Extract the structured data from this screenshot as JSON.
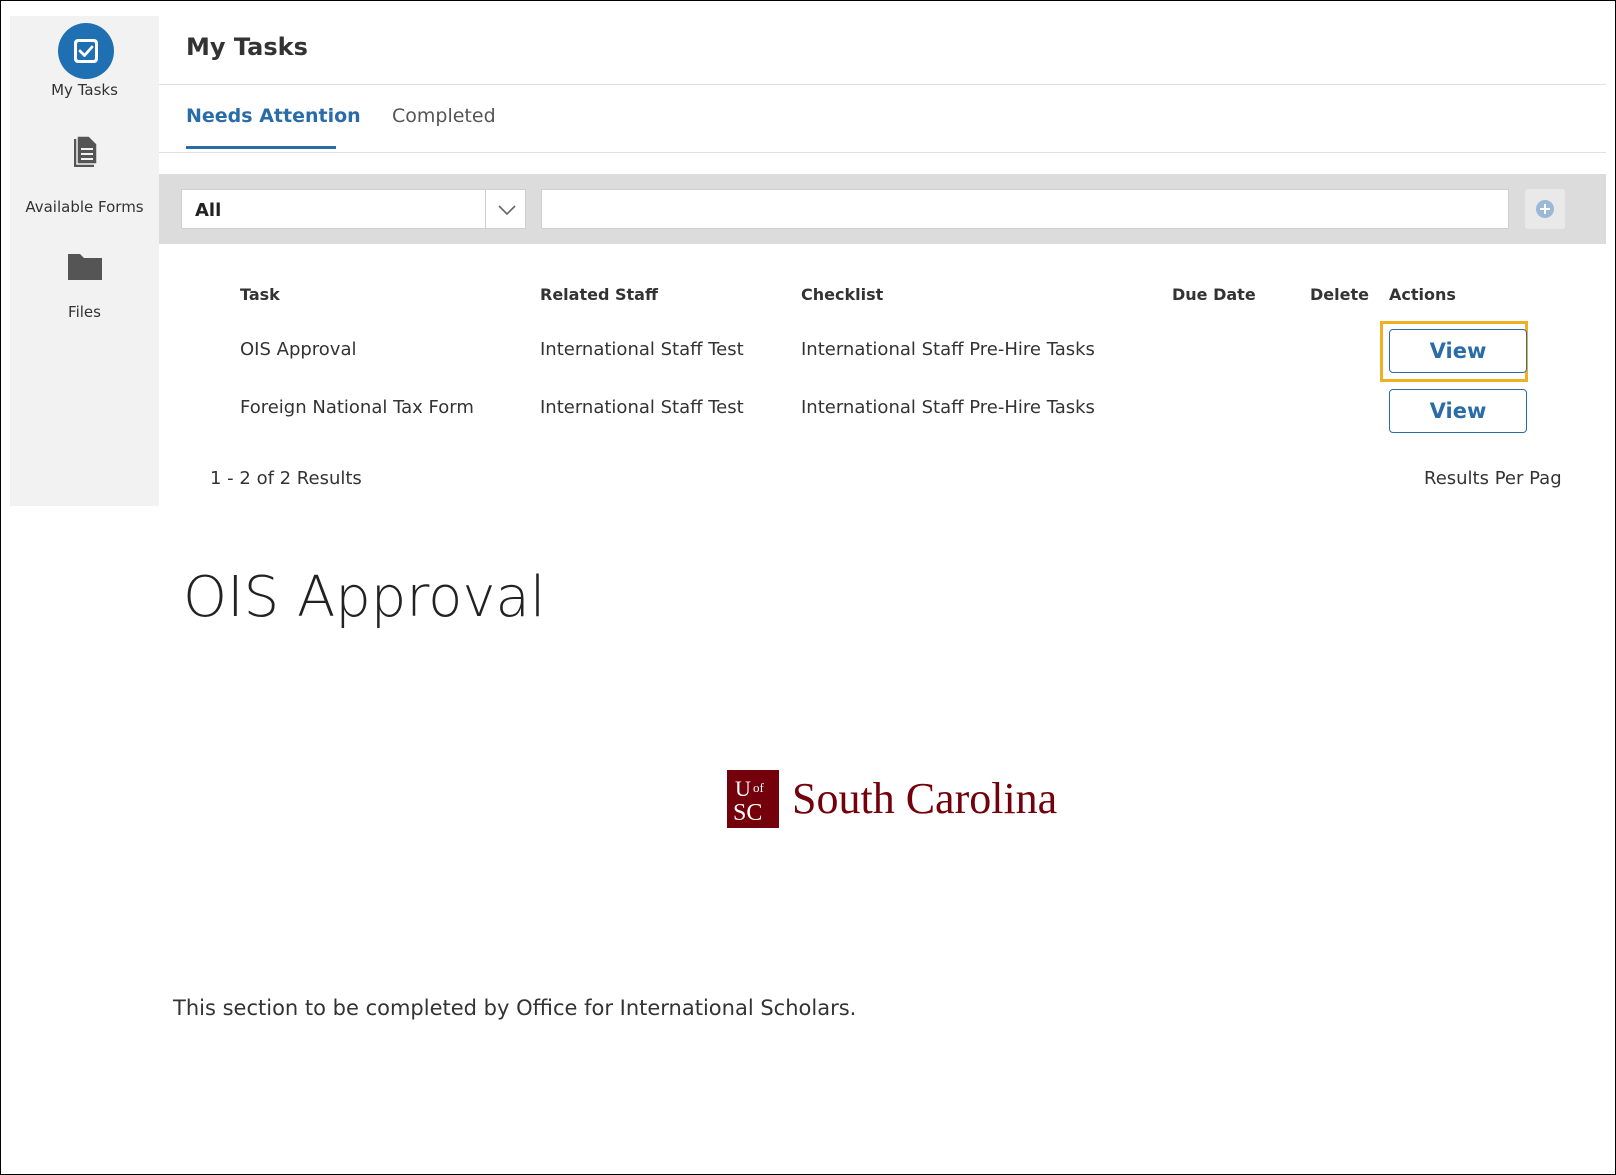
{
  "sidebar": {
    "items": [
      {
        "label": "My Tasks",
        "icon": "checkbox-icon"
      },
      {
        "label": "Available Forms",
        "icon": "document-icon"
      },
      {
        "label": "Files",
        "icon": "folder-icon"
      }
    ]
  },
  "header": {
    "title": "My Tasks"
  },
  "tabs": [
    {
      "label": "Needs Attention",
      "active": true
    },
    {
      "label": "Completed",
      "active": false
    }
  ],
  "filter": {
    "selected": "All",
    "search_value": ""
  },
  "table": {
    "columns": [
      "Task",
      "Related Staff",
      "Checklist",
      "Due Date",
      "Delete",
      "Actions"
    ],
    "rows": [
      {
        "task": "OIS Approval",
        "staff": "International Staff Test",
        "checklist": "International Staff Pre-Hire Tasks",
        "due": "",
        "action": "View"
      },
      {
        "task": "Foreign National Tax Form",
        "staff": "International Staff Test",
        "checklist": "International Staff Pre-Hire Tasks",
        "due": "",
        "action": "View"
      }
    ],
    "results": "1 - 2 of 2 Results",
    "per_page_label": "Results Per Pag"
  },
  "form": {
    "title": "OIS Approval",
    "logo_text": "South Carolina",
    "note": "This section to be completed by Office for International Scholars."
  },
  "colors": {
    "accent": "#2a6ca8",
    "highlight": "#f0b024",
    "brand": "#73000a"
  }
}
